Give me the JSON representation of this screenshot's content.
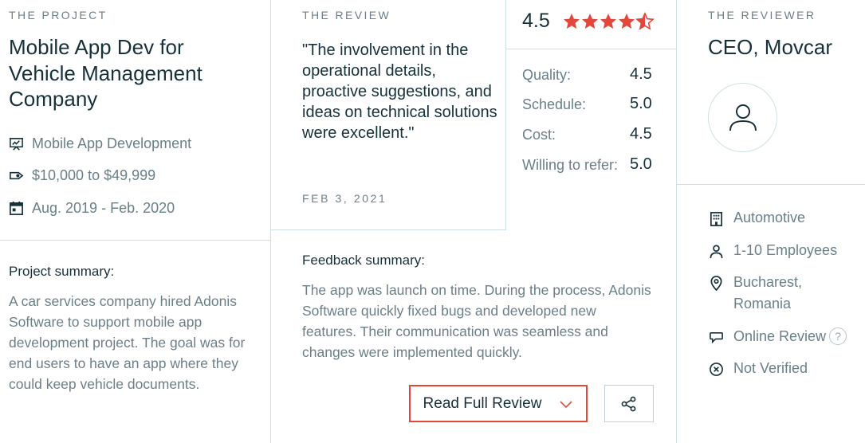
{
  "project": {
    "eyebrow": "THE PROJECT",
    "title": "Mobile App Dev for Vehicle Management Company",
    "service": "Mobile App Development",
    "budget": "$10,000 to $49,999",
    "dates": "Aug. 2019 - Feb. 2020",
    "summary_label": "Project summary:",
    "summary_text": "A car services company hired Adonis Software to support mobile app development project. The goal was for end users to have an app where they could keep vehicle documents."
  },
  "review": {
    "eyebrow": "THE REVIEW",
    "quote": "\"The involvement in the operational details, proactive suggestions, and ideas on technical solutions were excellent.\"",
    "date": "FEB 3, 2021",
    "overall": "4.5",
    "stars": 4.5,
    "scores": [
      {
        "label": "Quality:",
        "value": "4.5"
      },
      {
        "label": "Schedule:",
        "value": "5.0"
      },
      {
        "label": "Cost:",
        "value": "4.5"
      },
      {
        "label": "Willing to refer:",
        "value": "5.0"
      }
    ],
    "feedback_label": "Feedback summary:",
    "feedback_text": "The app was launch on time. During the process, Adonis Software quickly fixed bugs and developed new features. Their communication was seamless and changes were implemented quickly.",
    "read_button": "Read Full Review"
  },
  "reviewer": {
    "eyebrow": "THE REVIEWER",
    "title": "CEO, Movcar",
    "industry": "Automotive",
    "size": "1-10 Employees",
    "location": "Bucharest, Romania",
    "review_type": "Online Review",
    "verification": "Not Verified"
  },
  "colors": {
    "accent": "#e3463a",
    "text": "#17313b",
    "muted": "#6a7f87",
    "border": "#cfe0e4"
  },
  "icons": {
    "service": "presentation-icon",
    "budget": "price-tag-icon",
    "dates": "calendar-icon",
    "industry": "building-icon",
    "size": "person-icon",
    "location": "map-pin-icon",
    "review_type": "chat-bubble-icon",
    "verification": "x-circle-icon"
  }
}
